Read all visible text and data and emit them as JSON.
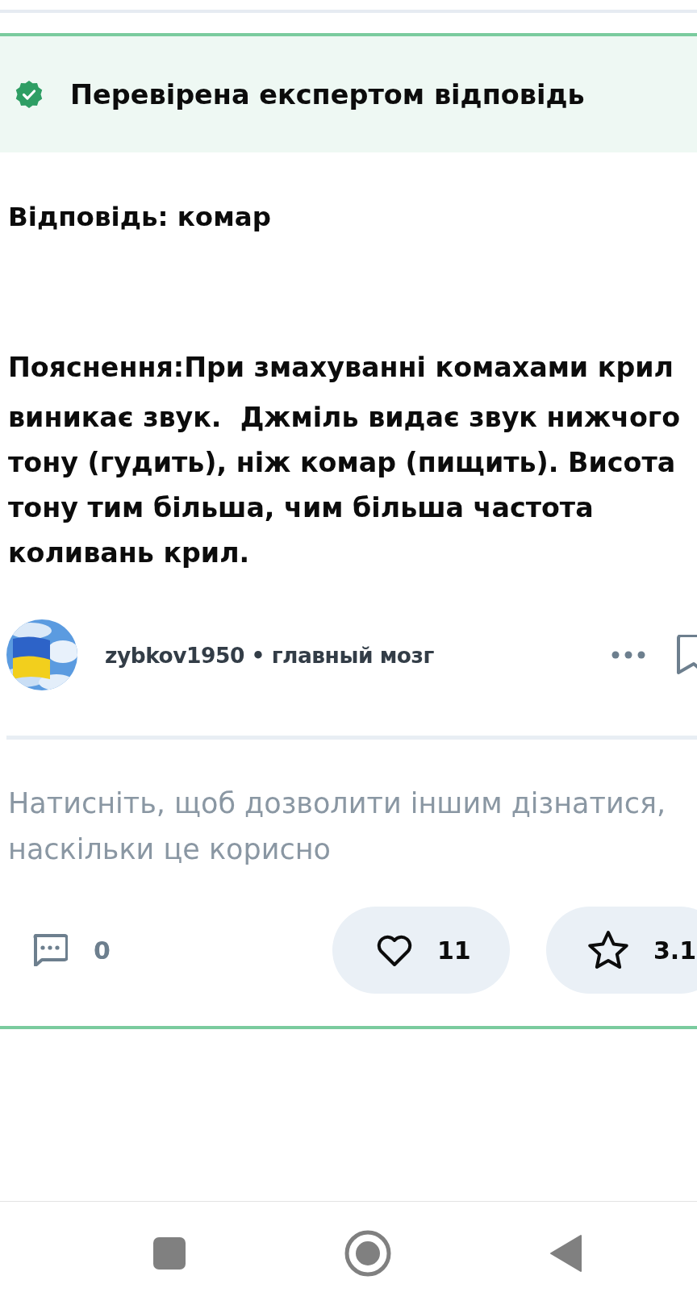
{
  "verified_banner": {
    "title": "Перевірена експертом відповідь"
  },
  "answer": {
    "text": "Відповідь: комар"
  },
  "explanation": {
    "paragraphs": [
      "Пояснення:При змахуванні комахами крил",
      "виникає звук.  Джміль видає звук нижчого тону (гудить), ніж комар (пищить). Висота тону тим більша, чим більша частота коливань крил."
    ]
  },
  "author": {
    "name": "zybkov1950 • главный мозг"
  },
  "rating_prompt": "Натисніть, щоб дозволити іншим дізнатися, наскільки це корисно",
  "actions": [
    {
      "kind": "comments",
      "count": "0"
    },
    {
      "kind": "likes",
      "count": "11"
    },
    {
      "kind": "rating",
      "count": "3.1"
    }
  ]
}
